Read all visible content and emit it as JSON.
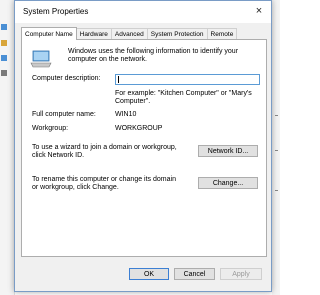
{
  "window": {
    "title": "System Properties",
    "close_glyph": "×"
  },
  "tabs": [
    {
      "label": "Computer Name",
      "active": true
    },
    {
      "label": "Hardware"
    },
    {
      "label": "Advanced"
    },
    {
      "label": "System Protection"
    },
    {
      "label": "Remote"
    }
  ],
  "intro": "Windows uses the following information to identify your computer on the network.",
  "description": {
    "label": "Computer description:",
    "value": "",
    "example": "For example: \"Kitchen Computer\" or \"Mary's Computer\"."
  },
  "full_name": {
    "label": "Full computer name:",
    "value": "WIN10"
  },
  "workgroup": {
    "label": "Workgroup:",
    "value": "WORKGROUP"
  },
  "network_id": {
    "text": "To use a wizard to join a domain or workgroup, click Network ID.",
    "button": "Network ID..."
  },
  "change": {
    "text": "To rename this computer or change its domain or workgroup, click Change.",
    "button": "Change..."
  },
  "footer": {
    "ok": "OK",
    "cancel": "Cancel",
    "apply": "Apply"
  },
  "colors": {
    "accent": "#3c7fd3",
    "border": "#adadad",
    "dialog_bg": "#f0f0f0"
  }
}
